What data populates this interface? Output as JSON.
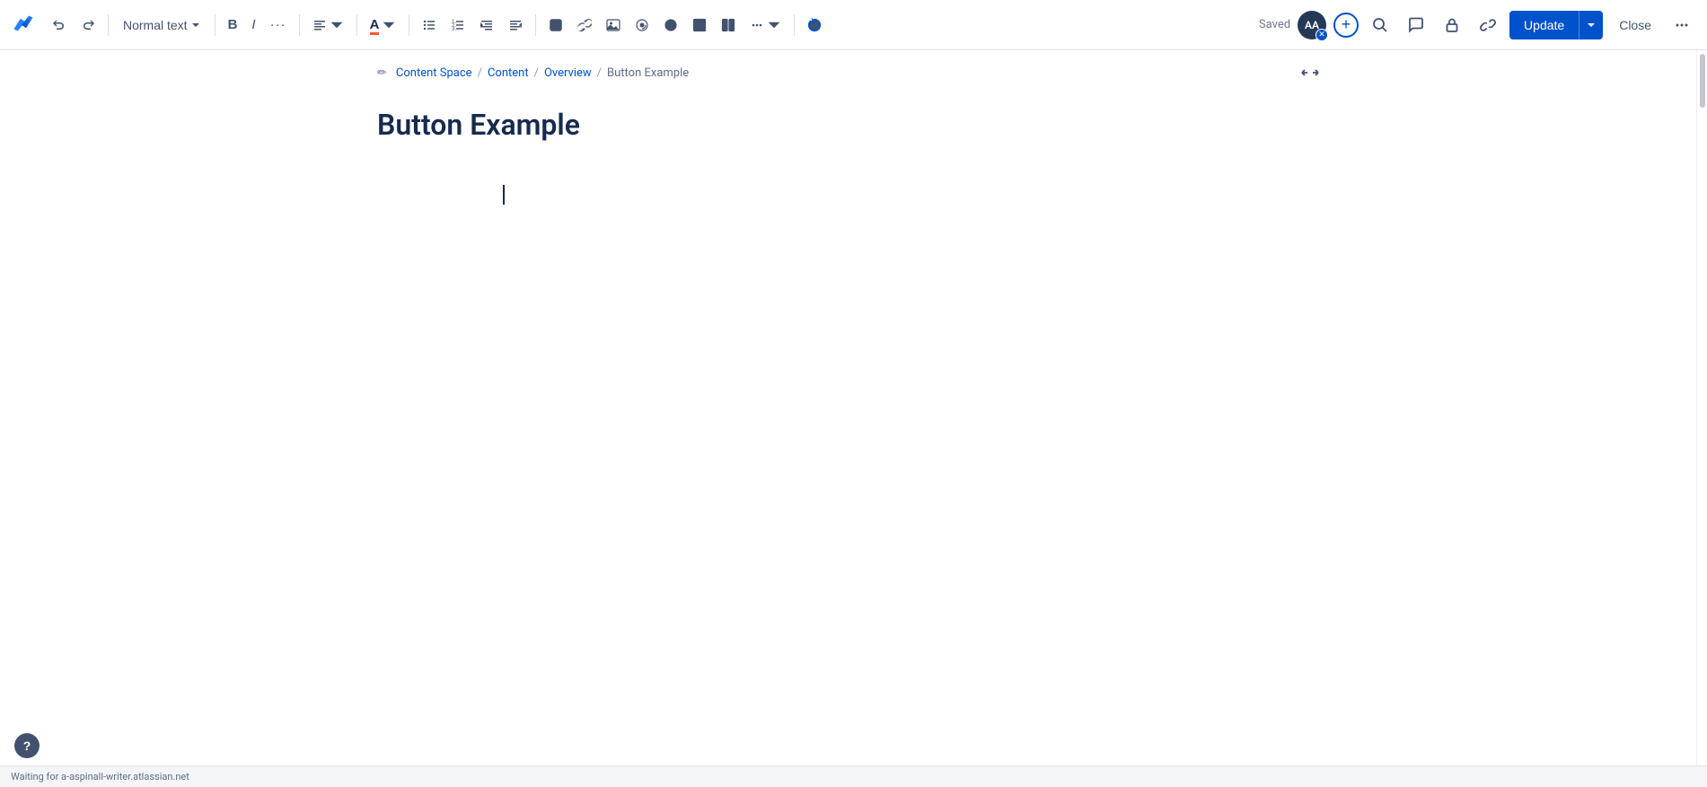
{
  "app": {
    "logo_text": "Confluence",
    "accent_color": "#0052CC"
  },
  "toolbar": {
    "text_style_label": "Normal text",
    "undo_label": "Undo",
    "redo_label": "Redo",
    "bold_label": "Bold",
    "italic_label": "Italic",
    "more_formatting_label": "More formatting",
    "align_label": "Align",
    "text_color_label": "Text color",
    "bullet_list_label": "Bullet list",
    "numbered_list_label": "Numbered list",
    "indent_left_label": "Outdent",
    "indent_right_label": "Indent",
    "action_item_label": "Action item",
    "link_label": "Link",
    "image_label": "Image",
    "mention_label": "Mention",
    "emoji_label": "Emoji",
    "table_label": "Table",
    "layout_label": "Layout",
    "insert_label": "Insert",
    "ai_label": "AI",
    "saved_text": "Saved",
    "avatar_initials": "AA",
    "add_label": "+",
    "search_label": "Search",
    "comment_label": "Comment",
    "restrict_label": "Restrict",
    "copy_link_label": "Copy link",
    "update_label": "Update",
    "update_dropdown_label": "▾",
    "close_label": "Close",
    "more_options_label": "···"
  },
  "breadcrumb": {
    "edit_icon": "✏",
    "items": [
      {
        "label": "Content Space",
        "is_link": true
      },
      {
        "label": "Content",
        "is_link": true
      },
      {
        "label": "Overview",
        "is_link": true
      },
      {
        "label": "Button Example",
        "is_link": false
      }
    ],
    "separator": "/"
  },
  "page": {
    "title": "Button Example"
  },
  "status_bar": {
    "text": "Waiting for a-aspinall-writer.atlassian.net"
  }
}
